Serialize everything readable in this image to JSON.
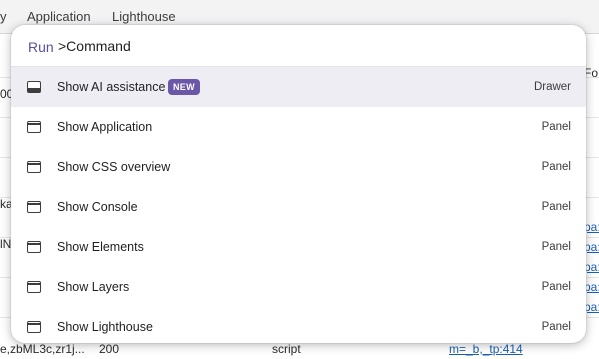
{
  "background": {
    "tabs": [
      "y",
      "Application",
      "Lighthouse"
    ],
    "left_fragments": [
      "00",
      "kal",
      "lNt"
    ],
    "right_fragments": [
      "Fo",
      "pa:",
      "pa:",
      "pa:",
      "pa:",
      "pa:"
    ],
    "bottom_row": {
      "name": "e,zbML3c,zr1j...",
      "status": "200",
      "type": "script",
      "initiator": "m=_b,_tp:414"
    }
  },
  "command_menu": {
    "prompt": "Run",
    "input_value": ">Command",
    "items": [
      {
        "label": "Show AI assistance",
        "badge": "NEW",
        "kind": "Drawer",
        "icon": "drawer-icon",
        "selected": true
      },
      {
        "label": "Show Application",
        "badge": "",
        "kind": "Panel",
        "icon": "panel-icon",
        "selected": false
      },
      {
        "label": "Show CSS overview",
        "badge": "",
        "kind": "Panel",
        "icon": "panel-icon",
        "selected": false
      },
      {
        "label": "Show Console",
        "badge": "",
        "kind": "Panel",
        "icon": "panel-icon",
        "selected": false
      },
      {
        "label": "Show Elements",
        "badge": "",
        "kind": "Panel",
        "icon": "panel-icon",
        "selected": false
      },
      {
        "label": "Show Layers",
        "badge": "",
        "kind": "Panel",
        "icon": "panel-icon",
        "selected": false
      },
      {
        "label": "Show Lighthouse",
        "badge": "",
        "kind": "Panel",
        "icon": "panel-icon",
        "selected": false
      }
    ]
  },
  "colors": {
    "accent": "#6b57a8",
    "selected_row": "#efedf4",
    "link": "#1a5fb4"
  }
}
